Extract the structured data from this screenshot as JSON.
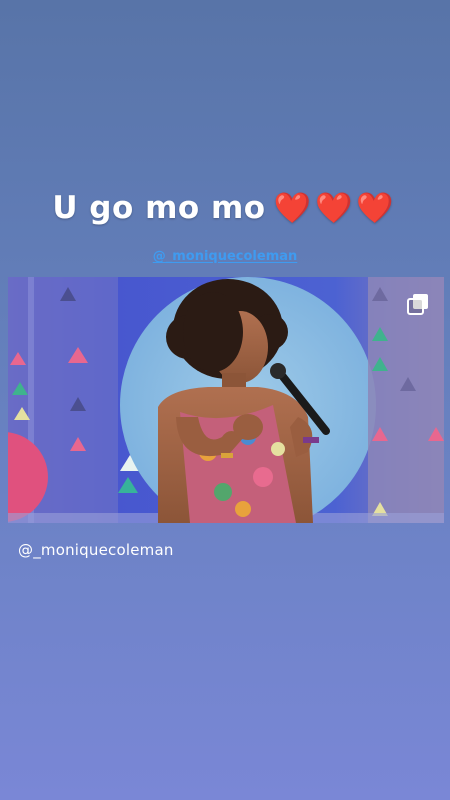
{
  "story": {
    "caption_text": "U go mo mo",
    "caption_hearts": "❤️❤️❤️",
    "mention_sticker": "@_moniquecoleman"
  },
  "post": {
    "author_handle": "@_moniquecoleman",
    "media_type_icon": "multiple-posts-icon",
    "image_icon": "speaker-on-stage-photo"
  },
  "colors": {
    "background_top": "#5874a8",
    "background_bottom": "#7a87d6",
    "mention_color": "#3f9bf0",
    "heart_color": "#e0162b"
  }
}
